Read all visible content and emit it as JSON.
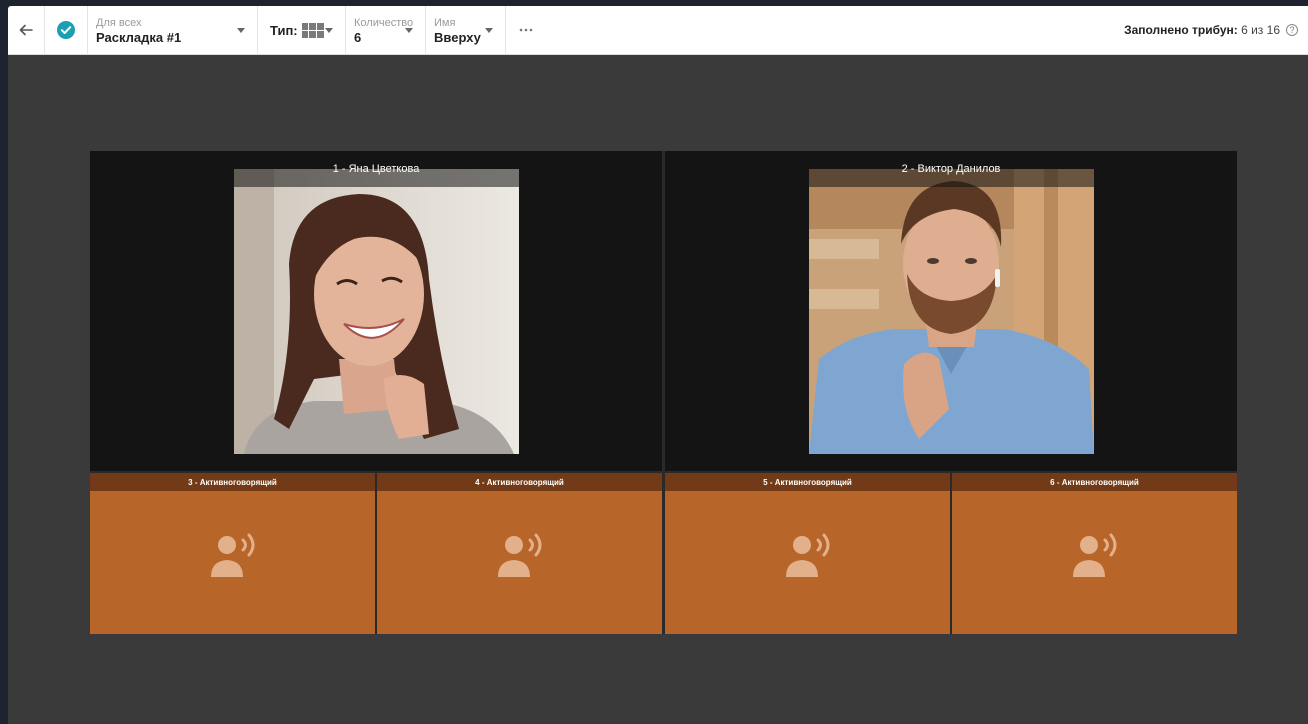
{
  "toolbar": {
    "layout": {
      "label": "Для всех",
      "value": "Раскладка #1"
    },
    "type": {
      "label": "Тип:",
      "icon": "grid-layout-icon"
    },
    "count": {
      "label": "Количество",
      "value": "6"
    },
    "name_pos": {
      "label": "Имя",
      "value": "Вверху"
    },
    "more_icon": "more-horizontal-icon",
    "fill_status": {
      "label": "Заполнено трибун:",
      "value": "6 из 16"
    }
  },
  "tiles": {
    "main": [
      {
        "title": "1 - Яна Цветкова"
      },
      {
        "title": "2 - Виктор Данилов"
      }
    ],
    "speakers": [
      {
        "title": "3 - Активноговорящий"
      },
      {
        "title": "4 - Активноговорящий"
      },
      {
        "title": "5 - Активноговорящий"
      },
      {
        "title": "6 - Активноговорящий"
      }
    ]
  },
  "colors": {
    "accent": "#1a9fb5",
    "speaker_tile": "#b8652a",
    "speaker_bar": "#723a16",
    "stage_bg": "#3a3a3a"
  }
}
